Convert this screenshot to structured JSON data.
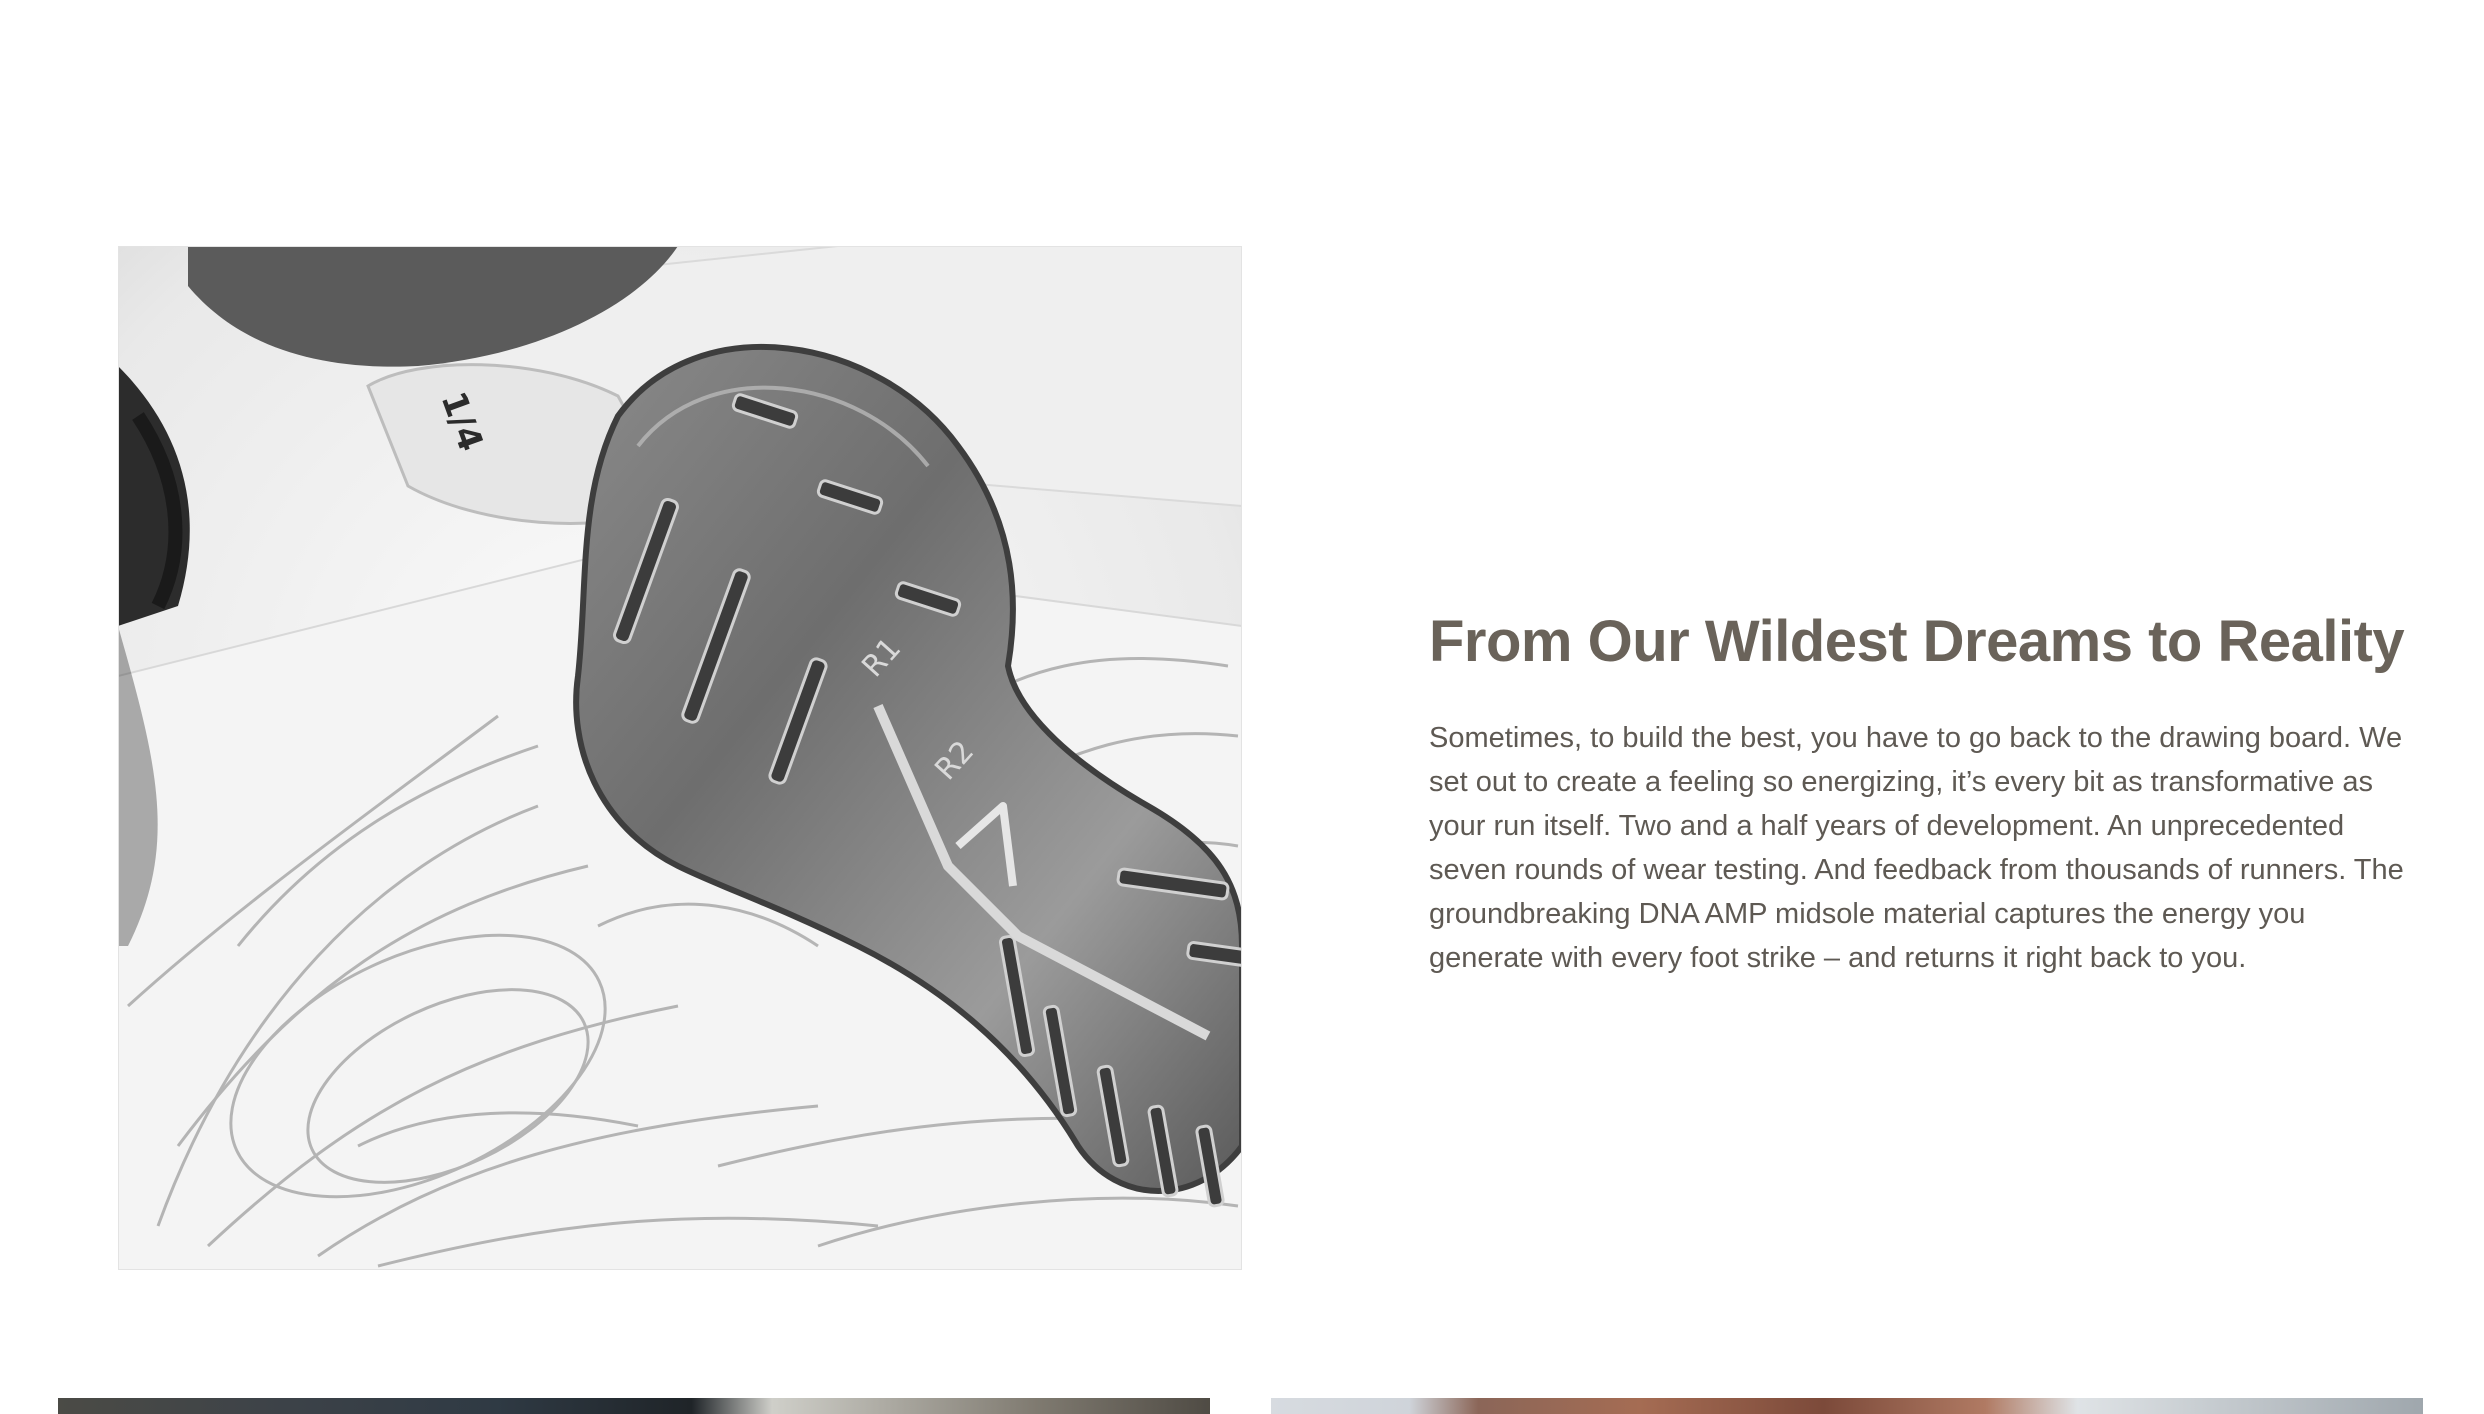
{
  "feature": {
    "image_alt": "Outsole sample resting on design sketches",
    "sole_labels": {
      "r1": "R1",
      "r2": "R2"
    },
    "headline": "From Our Wildest Dreams to Reality",
    "body": "Sometimes, to build the best, you have to go back to the drawing board. We set out to create a feeling so energizing, it’s every bit as transformative as your run itself. Two and a half years of development. An unprecedented seven rounds of wear testing. And feedback from thousands of runners. The groundbreaking DNA AMP midsole material captures the energy you generate with every foot strike – and returns it right back to you."
  },
  "colors": {
    "headline": "#6a635a",
    "body": "#5e5953",
    "background": "#ffffff"
  },
  "tiles": [
    {
      "name": "bottom-tile-left",
      "image": "runner-tile-left"
    },
    {
      "name": "bottom-tile-right",
      "image": "runner-tile-right"
    }
  ]
}
